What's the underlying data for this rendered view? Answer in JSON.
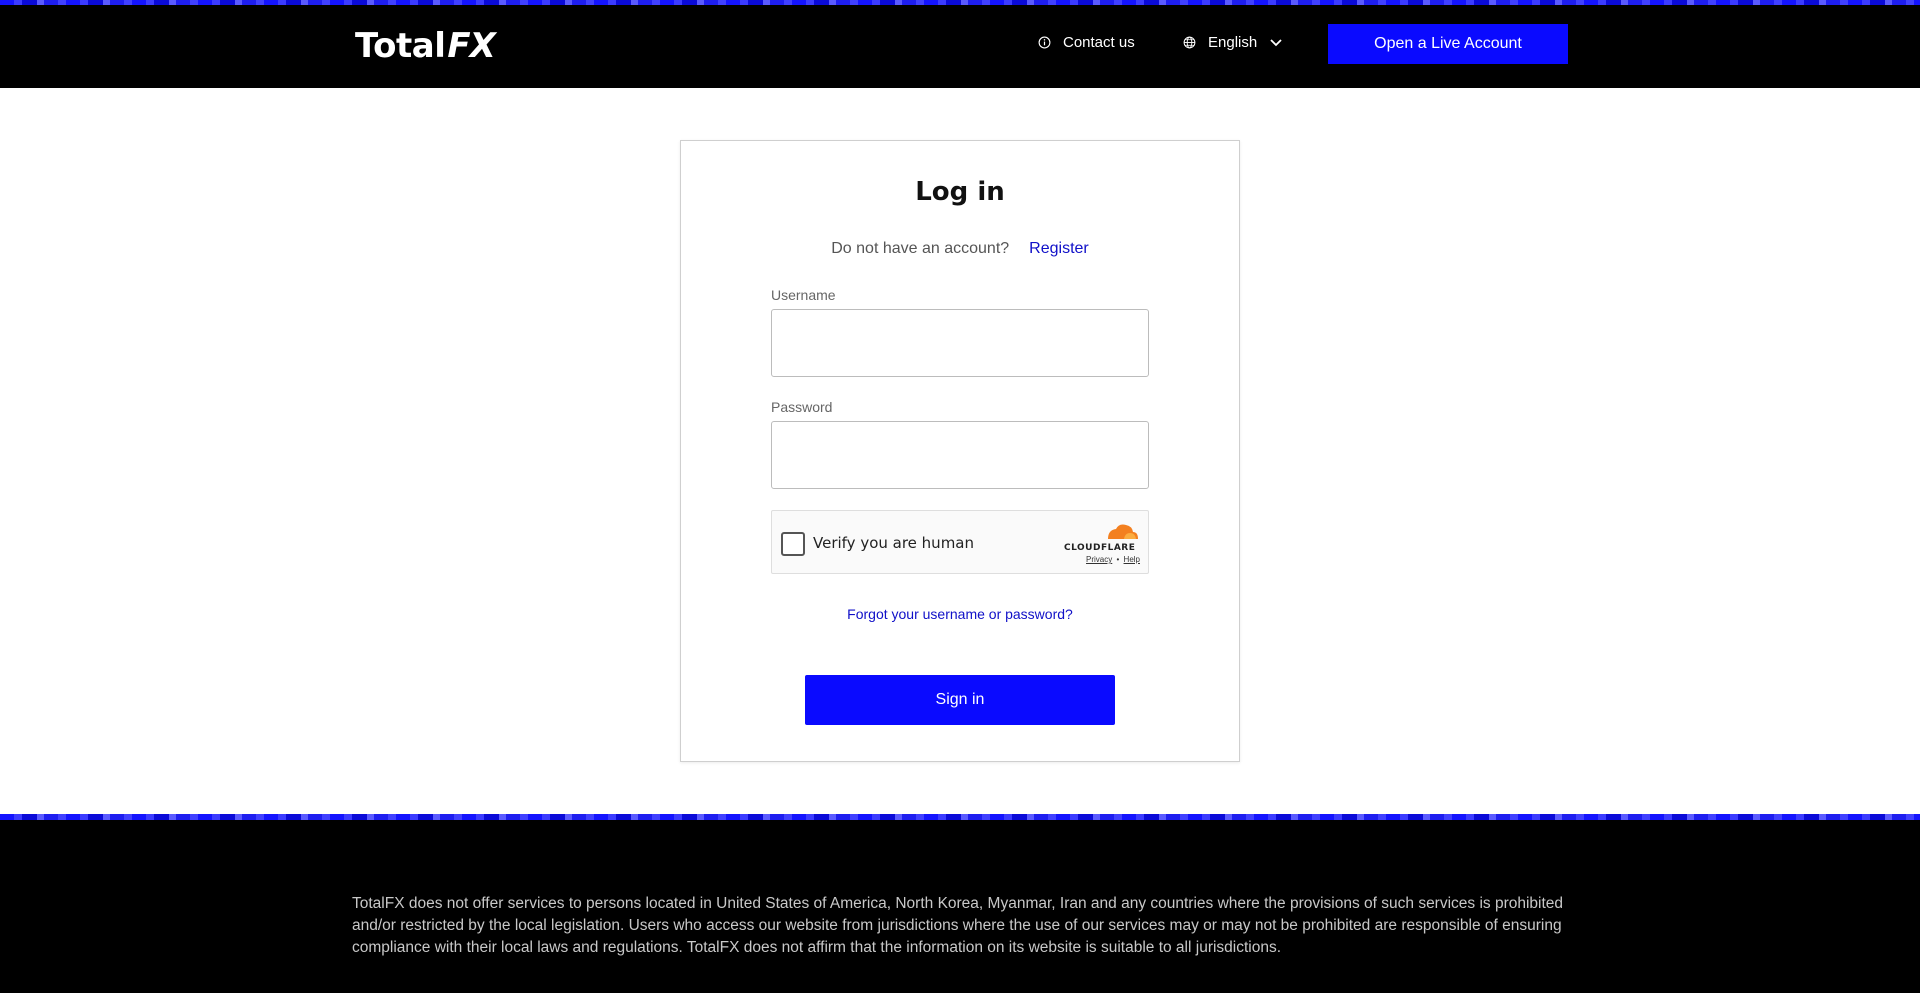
{
  "header": {
    "logo_main": "Total",
    "logo_fx": "FX",
    "contact_label": "Contact us",
    "language_label": "English",
    "cta_label": "Open a Live Account"
  },
  "login": {
    "title": "Log in",
    "no_account_text": "Do not have an account?",
    "register_label": "Register",
    "username_label": "Username",
    "username_value": "",
    "password_label": "Password",
    "password_value": "",
    "captcha_label": "Verify you are human",
    "captcha_brand": "CLOUDFLARE",
    "captcha_privacy": "Privacy",
    "captcha_separator": "•",
    "captcha_help": "Help",
    "forgot_label": "Forgot your username or password?",
    "signin_label": "Sign in"
  },
  "footer": {
    "disclaimer": "TotalFX does not offer services to persons located in United States of America, North Korea, Myanmar, Iran and any countries where the provisions of such services is prohibited and/or restricted by the local legislation. Users who access our website from jurisdictions where the use of our services may or may not be prohibited are responsible of ensuring compliance with their local laws and regulations. TotalFX does not affirm that the information on its website is suitable to all jurisdictions."
  },
  "colors": {
    "accent": "#0a0aff",
    "link": "#1010c8",
    "header_bg": "#000000"
  }
}
